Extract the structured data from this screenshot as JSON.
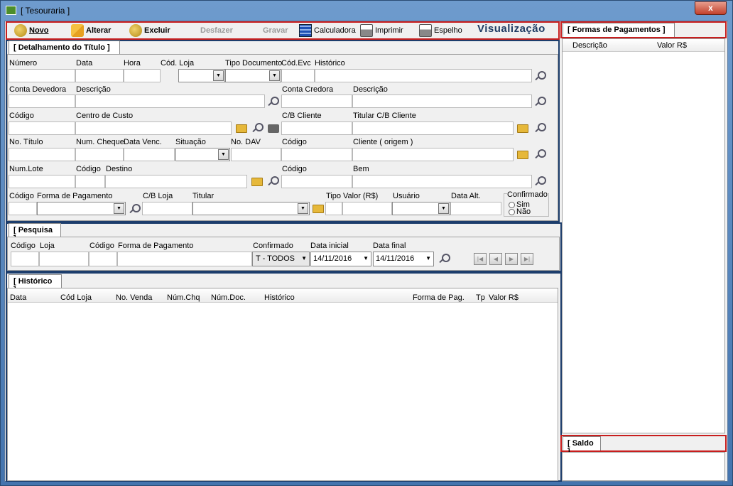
{
  "window": {
    "title": "[ Tesouraria ]",
    "close": "x"
  },
  "toolbar": {
    "novo": "Novo",
    "alterar": "Alterar",
    "excluir": "Excluir",
    "desfazer": "Desfazer",
    "gravar": "Gravar",
    "calculadora": "Calculadora",
    "imprimir": "Imprimir",
    "espelho": "Espelho",
    "visualizacao": "Visualização"
  },
  "detalhe": {
    "tab": "[ Detalhamento do Título ]",
    "numero": "Número",
    "data": "Data",
    "hora": "Hora",
    "cod_loja": "Cód. Loja",
    "tipo_documento": "Tipo Documento",
    "cod_evc": "Cód.Evc",
    "historico": "Histórico",
    "conta_devedora": "Conta Devedora",
    "descricao": "Descrição",
    "conta_credora": "Conta Credora",
    "descricao2": "Descrição",
    "codigo": "Código",
    "centro_custo": "Centro de Custo",
    "cb_cliente": "C/B Cliente",
    "titular_cb_cliente": "Titular C/B Cliente",
    "no_titulo": "No. Título",
    "num_cheque": "Num. Cheque",
    "data_venc": "Data Venc.",
    "situacao": "Situação",
    "no_dav": "No. DAV",
    "codigo2": "Código",
    "cliente_origem": "Cliente ( origem )",
    "num_lote": "Num.Lote",
    "codigo3": "Código",
    "destino": "Destino",
    "codigo4": "Código",
    "bem": "Bem",
    "codigo5": "Código",
    "forma_pagamento": "Forma de Pagamento",
    "cb_loja": "C/B Loja",
    "titular": "Titular",
    "tipo": "Tipo",
    "valor": "Valor (R$)",
    "usuario": "Usuário",
    "data_alt": "Data Alt.",
    "confirmado": "Confirmado",
    "sim": "Sim",
    "nao": "Não"
  },
  "pesquisa": {
    "tab": "[ Pesquisa ]",
    "codigo": "Código",
    "loja": "Loja",
    "codigo2": "Código",
    "forma_pagamento": "Forma de Pagamento",
    "confirmado": "Confirmado",
    "confirmado_value": "T - TODOS",
    "data_inicial": "Data inicial",
    "data_inicial_value": "14/11/2016",
    "data_final": "Data final",
    "data_final_value": "14/11/2016"
  },
  "historico": {
    "tab": "[ Histórico ]",
    "columns": [
      "Data",
      "Cód Loja",
      "No. Venda",
      "Núm.Chq",
      "Núm.Doc.",
      "Histórico",
      "Forma de Pag.",
      "Tp",
      "Valor R$"
    ]
  },
  "formas": {
    "tab": "[ Formas de Pagamentos ]",
    "col_descricao": "Descrição",
    "col_valor": "Valor R$"
  },
  "saldo": {
    "tab": "[ Saldo ]"
  }
}
